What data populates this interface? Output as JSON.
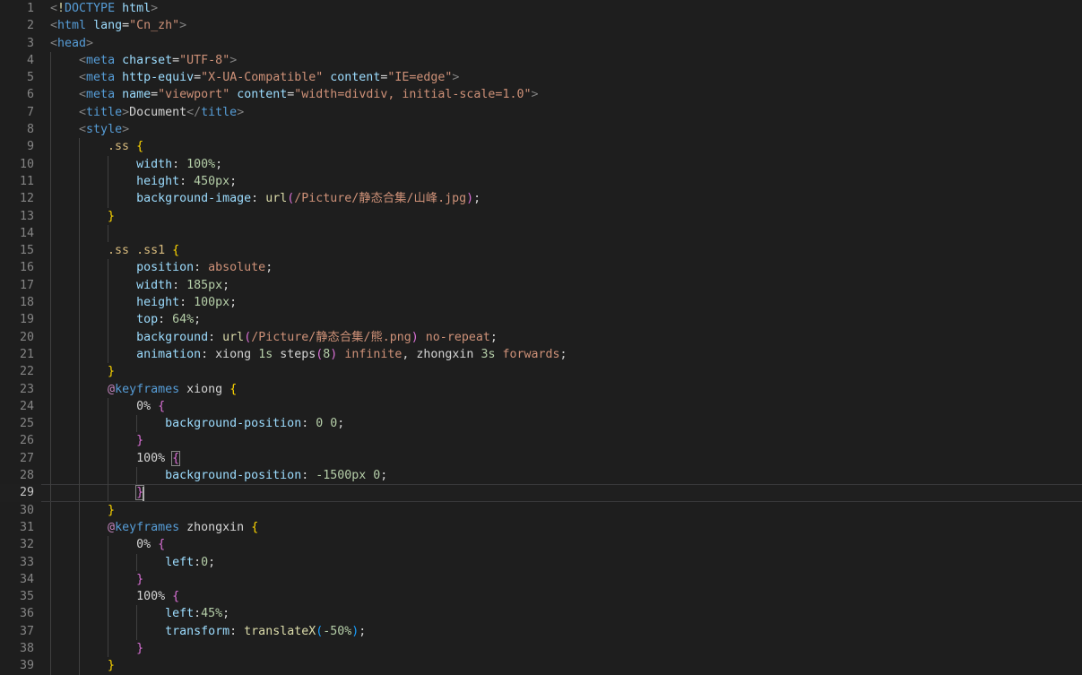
{
  "editor": {
    "theme_name": "dark-plus",
    "background": "#1e1e1e",
    "gutter_color": "#858585",
    "active_line_number_color": "#c6c6c6",
    "language": "html",
    "cursor_line": 29,
    "first_visible_line": 1,
    "last_visible_line": 39
  },
  "lines": [
    {
      "n": "1",
      "indent": 0,
      "tokens": [
        {
          "t": "<",
          "c": "t-punct"
        },
        {
          "t": "!",
          "c": "t-doct"
        },
        {
          "t": "DOCTYPE",
          "c": "t-tag"
        },
        {
          "t": " ",
          "c": "t-plain"
        },
        {
          "t": "html",
          "c": "t-attr"
        },
        {
          "t": ">",
          "c": "t-punct"
        }
      ]
    },
    {
      "n": "2",
      "indent": 0,
      "tokens": [
        {
          "t": "<",
          "c": "t-punct"
        },
        {
          "t": "html",
          "c": "t-tag"
        },
        {
          "t": " ",
          "c": "t-plain"
        },
        {
          "t": "lang",
          "c": "t-attr"
        },
        {
          "t": "=",
          "c": "t-eq"
        },
        {
          "t": "\"Cn_zh\"",
          "c": "t-str"
        },
        {
          "t": ">",
          "c": "t-punct"
        }
      ]
    },
    {
      "n": "3",
      "indent": 0,
      "tokens": [
        {
          "t": "<",
          "c": "t-punct"
        },
        {
          "t": "head",
          "c": "t-tag"
        },
        {
          "t": ">",
          "c": "t-punct"
        }
      ]
    },
    {
      "n": "4",
      "indent": 1,
      "tokens": [
        {
          "t": "    ",
          "c": "t-plain"
        },
        {
          "t": "<",
          "c": "t-punct"
        },
        {
          "t": "meta",
          "c": "t-tag"
        },
        {
          "t": " ",
          "c": "t-plain"
        },
        {
          "t": "charset",
          "c": "t-attr"
        },
        {
          "t": "=",
          "c": "t-eq"
        },
        {
          "t": "\"UTF-8\"",
          "c": "t-str"
        },
        {
          "t": ">",
          "c": "t-punct"
        }
      ]
    },
    {
      "n": "5",
      "indent": 1,
      "tokens": [
        {
          "t": "    ",
          "c": "t-plain"
        },
        {
          "t": "<",
          "c": "t-punct"
        },
        {
          "t": "meta",
          "c": "t-tag"
        },
        {
          "t": " ",
          "c": "t-plain"
        },
        {
          "t": "http-equiv",
          "c": "t-attr"
        },
        {
          "t": "=",
          "c": "t-eq"
        },
        {
          "t": "\"X-UA-Compatible\"",
          "c": "t-str"
        },
        {
          "t": " ",
          "c": "t-plain"
        },
        {
          "t": "content",
          "c": "t-attr"
        },
        {
          "t": "=",
          "c": "t-eq"
        },
        {
          "t": "\"IE=edge\"",
          "c": "t-str"
        },
        {
          "t": ">",
          "c": "t-punct"
        }
      ]
    },
    {
      "n": "6",
      "indent": 1,
      "tokens": [
        {
          "t": "    ",
          "c": "t-plain"
        },
        {
          "t": "<",
          "c": "t-punct"
        },
        {
          "t": "meta",
          "c": "t-tag"
        },
        {
          "t": " ",
          "c": "t-plain"
        },
        {
          "t": "name",
          "c": "t-attr"
        },
        {
          "t": "=",
          "c": "t-eq"
        },
        {
          "t": "\"viewport\"",
          "c": "t-str"
        },
        {
          "t": " ",
          "c": "t-plain"
        },
        {
          "t": "content",
          "c": "t-attr"
        },
        {
          "t": "=",
          "c": "t-eq"
        },
        {
          "t": "\"width=divdiv, initial-scale=1.0\"",
          "c": "t-str"
        },
        {
          "t": ">",
          "c": "t-punct"
        }
      ]
    },
    {
      "n": "7",
      "indent": 1,
      "tokens": [
        {
          "t": "    ",
          "c": "t-plain"
        },
        {
          "t": "<",
          "c": "t-punct"
        },
        {
          "t": "title",
          "c": "t-tag"
        },
        {
          "t": ">",
          "c": "t-punct"
        },
        {
          "t": "Document",
          "c": "t-text"
        },
        {
          "t": "</",
          "c": "t-punct"
        },
        {
          "t": "title",
          "c": "t-tag"
        },
        {
          "t": ">",
          "c": "t-punct"
        }
      ]
    },
    {
      "n": "8",
      "indent": 1,
      "tokens": [
        {
          "t": "    ",
          "c": "t-plain"
        },
        {
          "t": "<",
          "c": "t-punct"
        },
        {
          "t": "style",
          "c": "t-tag"
        },
        {
          "t": ">",
          "c": "t-punct"
        }
      ]
    },
    {
      "n": "9",
      "indent": 2,
      "tokens": [
        {
          "t": "        ",
          "c": "t-plain"
        },
        {
          "t": ".ss",
          "c": "t-sel"
        },
        {
          "t": " ",
          "c": "t-plain"
        },
        {
          "t": "{",
          "c": "t-br1"
        }
      ]
    },
    {
      "n": "10",
      "indent": 3,
      "tokens": [
        {
          "t": "            ",
          "c": "t-plain"
        },
        {
          "t": "width",
          "c": "t-prop"
        },
        {
          "t": ": ",
          "c": "t-plain"
        },
        {
          "t": "100%",
          "c": "t-num"
        },
        {
          "t": ";",
          "c": "t-plain"
        }
      ]
    },
    {
      "n": "11",
      "indent": 3,
      "tokens": [
        {
          "t": "            ",
          "c": "t-plain"
        },
        {
          "t": "height",
          "c": "t-prop"
        },
        {
          "t": ": ",
          "c": "t-plain"
        },
        {
          "t": "450px",
          "c": "t-num"
        },
        {
          "t": ";",
          "c": "t-plain"
        }
      ]
    },
    {
      "n": "12",
      "indent": 3,
      "tokens": [
        {
          "t": "            ",
          "c": "t-plain"
        },
        {
          "t": "background-image",
          "c": "t-prop"
        },
        {
          "t": ": ",
          "c": "t-plain"
        },
        {
          "t": "url",
          "c": "t-fn"
        },
        {
          "t": "(",
          "c": "t-br2"
        },
        {
          "t": "/Picture/静态合集/山峰.jpg",
          "c": "t-str"
        },
        {
          "t": ")",
          "c": "t-br2"
        },
        {
          "t": ";",
          "c": "t-plain"
        }
      ]
    },
    {
      "n": "13",
      "indent": 2,
      "tokens": [
        {
          "t": "        ",
          "c": "t-plain"
        },
        {
          "t": "}",
          "c": "t-br1"
        }
      ]
    },
    {
      "n": "14",
      "indent": 0,
      "tokens": []
    },
    {
      "n": "15",
      "indent": 2,
      "tokens": [
        {
          "t": "        ",
          "c": "t-plain"
        },
        {
          "t": ".ss .ss1",
          "c": "t-sel"
        },
        {
          "t": " ",
          "c": "t-plain"
        },
        {
          "t": "{",
          "c": "t-br1"
        }
      ]
    },
    {
      "n": "16",
      "indent": 3,
      "tokens": [
        {
          "t": "            ",
          "c": "t-plain"
        },
        {
          "t": "position",
          "c": "t-prop"
        },
        {
          "t": ": ",
          "c": "t-plain"
        },
        {
          "t": "absolute",
          "c": "t-kw"
        },
        {
          "t": ";",
          "c": "t-plain"
        }
      ]
    },
    {
      "n": "17",
      "indent": 3,
      "tokens": [
        {
          "t": "            ",
          "c": "t-plain"
        },
        {
          "t": "width",
          "c": "t-prop"
        },
        {
          "t": ": ",
          "c": "t-plain"
        },
        {
          "t": "185px",
          "c": "t-num"
        },
        {
          "t": ";",
          "c": "t-plain"
        }
      ]
    },
    {
      "n": "18",
      "indent": 3,
      "tokens": [
        {
          "t": "            ",
          "c": "t-plain"
        },
        {
          "t": "height",
          "c": "t-prop"
        },
        {
          "t": ": ",
          "c": "t-plain"
        },
        {
          "t": "100px",
          "c": "t-num"
        },
        {
          "t": ";",
          "c": "t-plain"
        }
      ]
    },
    {
      "n": "19",
      "indent": 3,
      "tokens": [
        {
          "t": "            ",
          "c": "t-plain"
        },
        {
          "t": "top",
          "c": "t-prop"
        },
        {
          "t": ": ",
          "c": "t-plain"
        },
        {
          "t": "64%",
          "c": "t-num"
        },
        {
          "t": ";",
          "c": "t-plain"
        }
      ]
    },
    {
      "n": "20",
      "indent": 3,
      "tokens": [
        {
          "t": "            ",
          "c": "t-plain"
        },
        {
          "t": "background",
          "c": "t-prop"
        },
        {
          "t": ": ",
          "c": "t-plain"
        },
        {
          "t": "url",
          "c": "t-fn"
        },
        {
          "t": "(",
          "c": "t-br2"
        },
        {
          "t": "/Picture/静态合集/熊.png",
          "c": "t-str"
        },
        {
          "t": ")",
          "c": "t-br2"
        },
        {
          "t": " ",
          "c": "t-plain"
        },
        {
          "t": "no-repeat",
          "c": "t-kw"
        },
        {
          "t": ";",
          "c": "t-plain"
        }
      ]
    },
    {
      "n": "21",
      "indent": 3,
      "tokens": [
        {
          "t": "            ",
          "c": "t-plain"
        },
        {
          "t": "animation",
          "c": "t-prop"
        },
        {
          "t": ": ",
          "c": "t-plain"
        },
        {
          "t": "xiong",
          "c": "t-plain"
        },
        {
          "t": " ",
          "c": "t-plain"
        },
        {
          "t": "1s",
          "c": "t-num"
        },
        {
          "t": " ",
          "c": "t-plain"
        },
        {
          "t": "steps",
          "c": "t-plain"
        },
        {
          "t": "(",
          "c": "t-br2"
        },
        {
          "t": "8",
          "c": "t-num"
        },
        {
          "t": ")",
          "c": "t-br2"
        },
        {
          "t": " ",
          "c": "t-plain"
        },
        {
          "t": "infinite",
          "c": "t-kw"
        },
        {
          "t": ", ",
          "c": "t-plain"
        },
        {
          "t": "zhongxin",
          "c": "t-plain"
        },
        {
          "t": " ",
          "c": "t-plain"
        },
        {
          "t": "3s",
          "c": "t-num"
        },
        {
          "t": " ",
          "c": "t-plain"
        },
        {
          "t": "forwards",
          "c": "t-kw"
        },
        {
          "t": ";",
          "c": "t-plain"
        }
      ]
    },
    {
      "n": "22",
      "indent": 2,
      "tokens": [
        {
          "t": "        ",
          "c": "t-plain"
        },
        {
          "t": "}",
          "c": "t-br1"
        }
      ]
    },
    {
      "n": "23",
      "indent": 2,
      "tokens": [
        {
          "t": "        ",
          "c": "t-plain"
        },
        {
          "t": "@",
          "c": "t-at"
        },
        {
          "t": "keyframes",
          "c": "t-atname"
        },
        {
          "t": " ",
          "c": "t-plain"
        },
        {
          "t": "xiong",
          "c": "t-plain"
        },
        {
          "t": " ",
          "c": "t-plain"
        },
        {
          "t": "{",
          "c": "t-br1"
        }
      ]
    },
    {
      "n": "24",
      "indent": 3,
      "tokens": [
        {
          "t": "            ",
          "c": "t-plain"
        },
        {
          "t": "0%",
          "c": "t-plain"
        },
        {
          "t": " ",
          "c": "t-plain"
        },
        {
          "t": "{",
          "c": "t-br2"
        }
      ]
    },
    {
      "n": "25",
      "indent": 4,
      "tokens": [
        {
          "t": "                ",
          "c": "t-plain"
        },
        {
          "t": "background-position",
          "c": "t-prop"
        },
        {
          "t": ": ",
          "c": "t-plain"
        },
        {
          "t": "0 0",
          "c": "t-num"
        },
        {
          "t": ";",
          "c": "t-plain"
        }
      ]
    },
    {
      "n": "26",
      "indent": 3,
      "tokens": [
        {
          "t": "            ",
          "c": "t-plain"
        },
        {
          "t": "}",
          "c": "t-br2"
        }
      ]
    },
    {
      "n": "27",
      "indent": 3,
      "tokens": [
        {
          "t": "            ",
          "c": "t-plain"
        },
        {
          "t": "100%",
          "c": "t-plain"
        },
        {
          "t": " ",
          "c": "t-plain"
        },
        {
          "t": "{",
          "c": "t-br2",
          "match": true
        }
      ]
    },
    {
      "n": "28",
      "indent": 4,
      "tokens": [
        {
          "t": "                ",
          "c": "t-plain"
        },
        {
          "t": "background-position",
          "c": "t-prop"
        },
        {
          "t": ": ",
          "c": "t-plain"
        },
        {
          "t": "-1500px 0",
          "c": "t-num"
        },
        {
          "t": ";",
          "c": "t-plain"
        }
      ]
    },
    {
      "n": "29",
      "indent": 3,
      "active": true,
      "tokens": [
        {
          "t": "            ",
          "c": "t-plain"
        },
        {
          "t": "}",
          "c": "t-br2",
          "match": true
        },
        {
          "t": "",
          "c": "cursor"
        }
      ]
    },
    {
      "n": "30",
      "indent": 2,
      "tokens": [
        {
          "t": "        ",
          "c": "t-plain"
        },
        {
          "t": "}",
          "c": "t-br1"
        }
      ]
    },
    {
      "n": "31",
      "indent": 2,
      "tokens": [
        {
          "t": "        ",
          "c": "t-plain"
        },
        {
          "t": "@",
          "c": "t-at"
        },
        {
          "t": "keyframes",
          "c": "t-atname"
        },
        {
          "t": " ",
          "c": "t-plain"
        },
        {
          "t": "zhongxin",
          "c": "t-plain"
        },
        {
          "t": " ",
          "c": "t-plain"
        },
        {
          "t": "{",
          "c": "t-br1"
        }
      ]
    },
    {
      "n": "32",
      "indent": 3,
      "tokens": [
        {
          "t": "            ",
          "c": "t-plain"
        },
        {
          "t": "0%",
          "c": "t-plain"
        },
        {
          "t": " ",
          "c": "t-plain"
        },
        {
          "t": "{",
          "c": "t-br2"
        }
      ]
    },
    {
      "n": "33",
      "indent": 4,
      "tokens": [
        {
          "t": "                ",
          "c": "t-plain"
        },
        {
          "t": "left",
          "c": "t-prop"
        },
        {
          "t": ":",
          "c": "t-plain"
        },
        {
          "t": "0",
          "c": "t-num"
        },
        {
          "t": ";",
          "c": "t-plain"
        }
      ]
    },
    {
      "n": "34",
      "indent": 3,
      "tokens": [
        {
          "t": "            ",
          "c": "t-plain"
        },
        {
          "t": "}",
          "c": "t-br2"
        }
      ]
    },
    {
      "n": "35",
      "indent": 3,
      "tokens": [
        {
          "t": "            ",
          "c": "t-plain"
        },
        {
          "t": "100%",
          "c": "t-plain"
        },
        {
          "t": " ",
          "c": "t-plain"
        },
        {
          "t": "{",
          "c": "t-br2"
        }
      ]
    },
    {
      "n": "36",
      "indent": 4,
      "tokens": [
        {
          "t": "                ",
          "c": "t-plain"
        },
        {
          "t": "left",
          "c": "t-prop"
        },
        {
          "t": ":",
          "c": "t-plain"
        },
        {
          "t": "45%",
          "c": "t-num"
        },
        {
          "t": ";",
          "c": "t-plain"
        }
      ]
    },
    {
      "n": "37",
      "indent": 4,
      "tokens": [
        {
          "t": "                ",
          "c": "t-plain"
        },
        {
          "t": "transform",
          "c": "t-prop"
        },
        {
          "t": ": ",
          "c": "t-plain"
        },
        {
          "t": "translateX",
          "c": "t-fn"
        },
        {
          "t": "(",
          "c": "t-br3"
        },
        {
          "t": "-50%",
          "c": "t-num"
        },
        {
          "t": ")",
          "c": "t-br3"
        },
        {
          "t": ";",
          "c": "t-plain"
        }
      ]
    },
    {
      "n": "38",
      "indent": 3,
      "tokens": [
        {
          "t": "            ",
          "c": "t-plain"
        },
        {
          "t": "}",
          "c": "t-br2"
        }
      ]
    },
    {
      "n": "39",
      "indent": 2,
      "tokens": [
        {
          "t": "        ",
          "c": "t-plain"
        },
        {
          "t": "}",
          "c": "t-br1"
        }
      ]
    }
  ]
}
